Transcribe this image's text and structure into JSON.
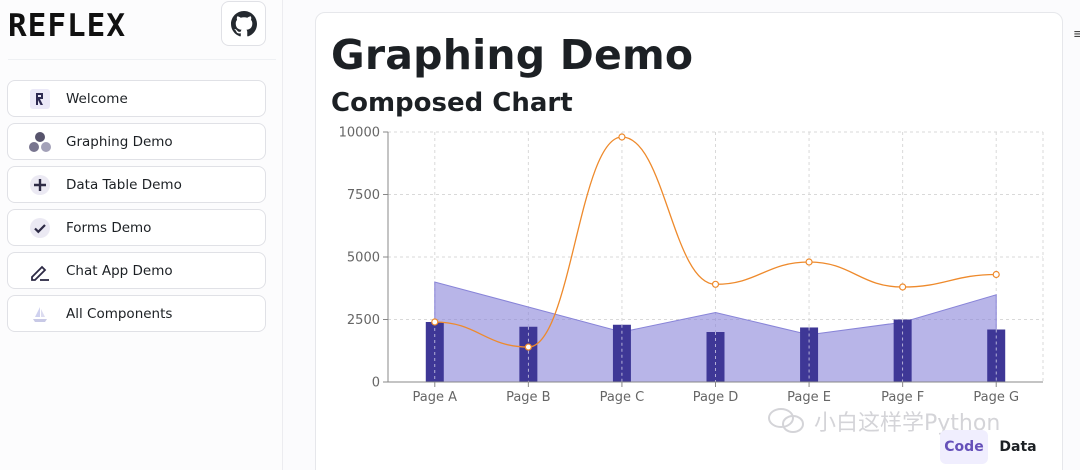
{
  "sidebar": {
    "logo_text": "REFLEX",
    "github_icon": "github-icon",
    "items": [
      {
        "label": "Welcome",
        "icon": "reflex-r-icon"
      },
      {
        "label": "Graphing Demo",
        "icon": "circles-icon"
      },
      {
        "label": "Data Table Demo",
        "icon": "plus-circle-icon"
      },
      {
        "label": "Forms Demo",
        "icon": "check-circle-icon"
      },
      {
        "label": "Chat App Demo",
        "icon": "pencil-icon"
      },
      {
        "label": "All Components",
        "icon": "sailboat-icon"
      }
    ]
  },
  "main": {
    "title": "Graphing Demo",
    "subtitle": "Composed Chart",
    "tabs": [
      {
        "label": "Code",
        "active": true
      },
      {
        "label": "Data",
        "active": false
      }
    ]
  },
  "watermark": "小白这样学Python",
  "chart_data": {
    "type": "composed",
    "categories": [
      "Page A",
      "Page B",
      "Page C",
      "Page D",
      "Page E",
      "Page F",
      "Page G"
    ],
    "ylim": [
      0,
      10000
    ],
    "yticks": [
      "0",
      "2500",
      "5000",
      "7500",
      "10000"
    ],
    "grid": true,
    "series": [
      {
        "kind": "area",
        "values": [
          4000,
          3000,
          2000,
          2780,
          1890,
          2390,
          3490
        ],
        "color": "#8884d8"
      },
      {
        "kind": "bar",
        "values": [
          2400,
          2210,
          2290,
          2000,
          2181,
          2500,
          2100
        ],
        "color": "#3e3796"
      },
      {
        "kind": "line",
        "values": [
          2400,
          1398,
          9800,
          3908,
          4800,
          3800,
          4300
        ],
        "color": "#ee8a2c"
      }
    ]
  },
  "colors": {
    "accent": "#6550b9",
    "accent_bg": "#f0eefe",
    "text": "#1c2024"
  }
}
